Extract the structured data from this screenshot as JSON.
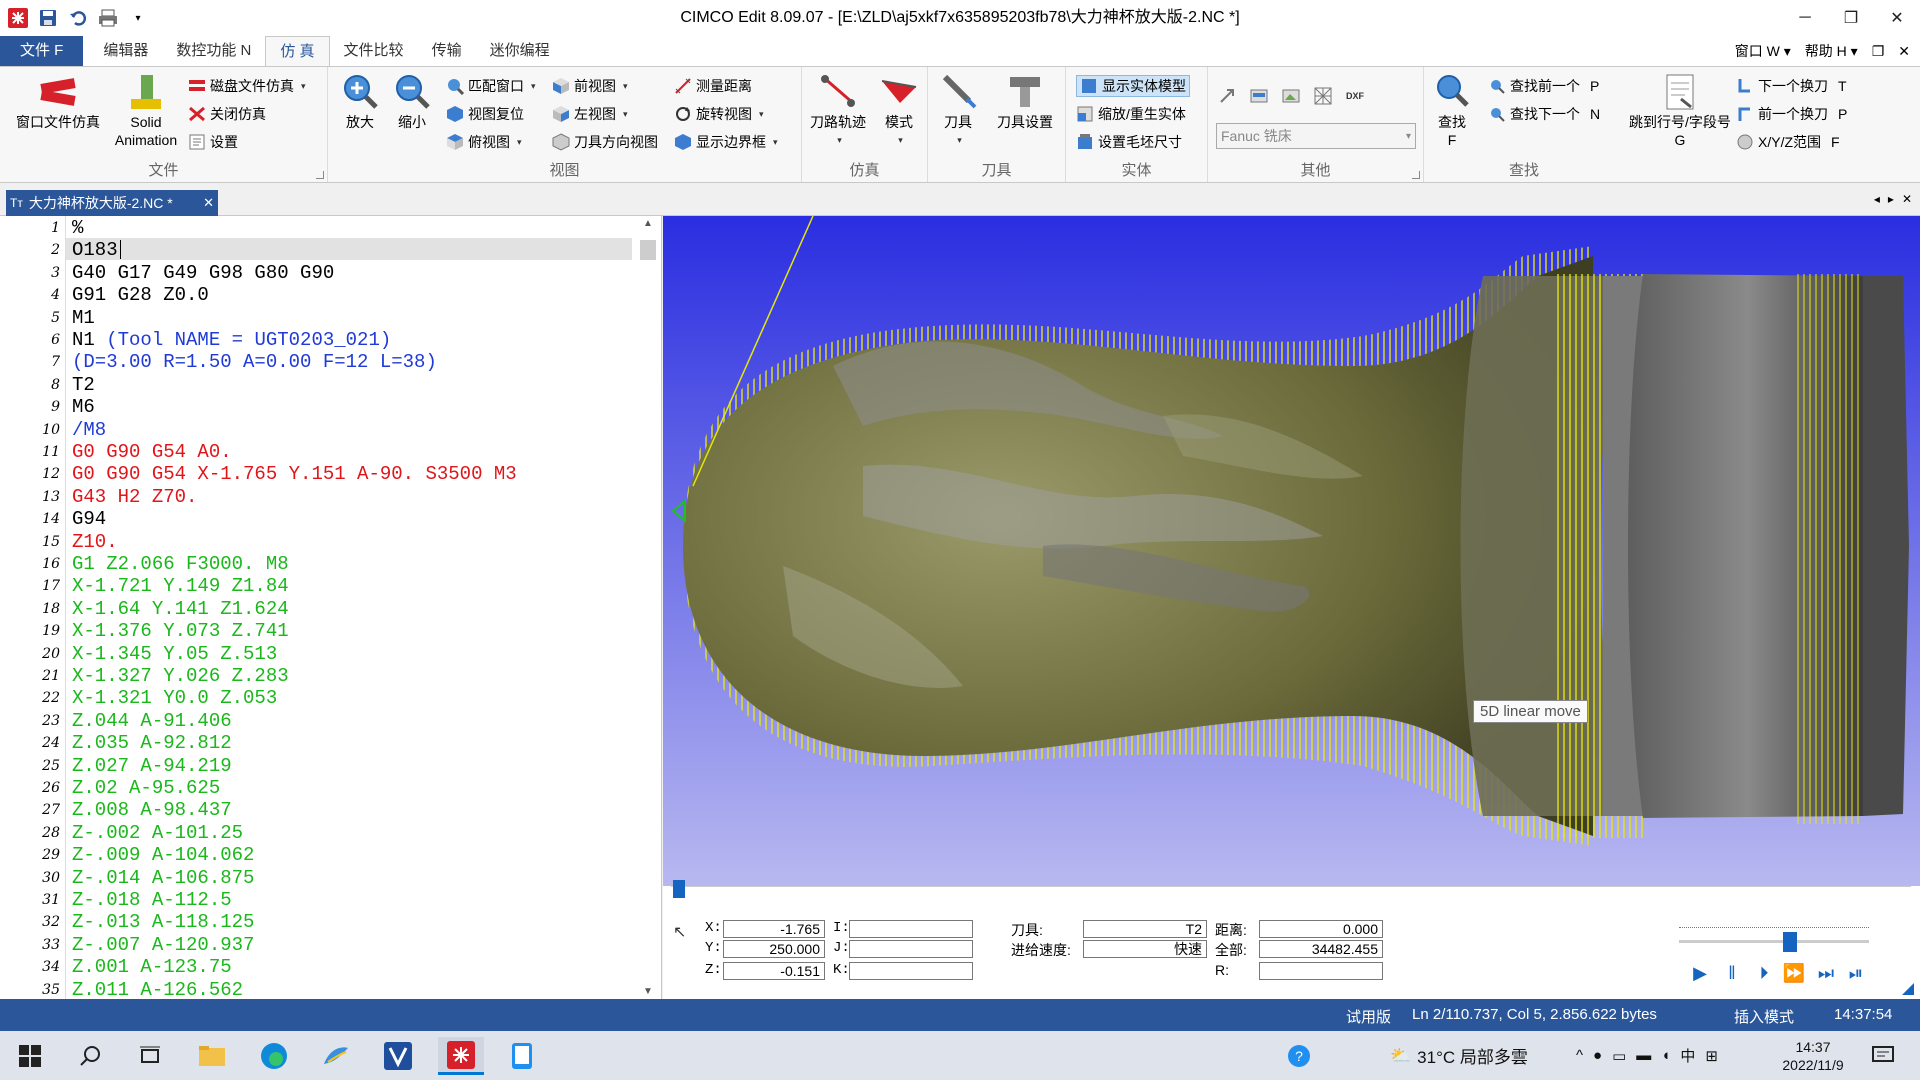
{
  "window": {
    "title": "CIMCO Edit 8.09.07 - [E:\\ZLD\\aj5xkf7x635895203fb78\\大力神杯放大版-2.NC *]"
  },
  "tabs": [
    {
      "label": "文件 F"
    },
    {
      "label": "编辑器"
    },
    {
      "label": "数控功能 N"
    },
    {
      "label": "仿 真"
    },
    {
      "label": "文件比较"
    },
    {
      "label": "传输"
    },
    {
      "label": "迷你编程"
    }
  ],
  "tabs_right": {
    "window_menu": "窗口 W",
    "help_menu": "帮助 H"
  },
  "ribbon": {
    "file_group": {
      "label": "文件",
      "window_file_sim": "窗口文件仿真",
      "solid_animation": "Solid\nAnimation",
      "disk_file_sim": "磁盘文件仿真",
      "close_sim": "关闭仿真",
      "settings": "设置"
    },
    "view_group": {
      "label": "视图",
      "zoom_in": "放大",
      "zoom_out": "缩小",
      "fit_window": "匹配窗口",
      "reset_view": "视图复位",
      "top_view": "俯视图",
      "front_view": "前视图",
      "left_view": "左视图",
      "tool_dir_view": "刀具方向视图",
      "measure": "测量距离",
      "rotate_view": "旋转视图",
      "show_bounds": "显示边界框"
    },
    "sim_group": {
      "label": "仿真",
      "toolpath": "刀路轨迹",
      "mode": "模式"
    },
    "tool_group": {
      "label": "刀具",
      "tool": "刀具",
      "tool_settings": "刀具设置"
    },
    "solid_group": {
      "label": "实体",
      "show_solid": "显示实体模型",
      "scale_regen": "缩放/重生实体",
      "stock_size": "设置毛坯尺寸"
    },
    "other_group": {
      "label": "其他",
      "machine_select": "Fanuc 铣床"
    },
    "find_group": {
      "label": "查找",
      "find": "查找",
      "find_key": "F",
      "find_prev": "查找前一个",
      "find_prev_key": "P",
      "find_next": "查找下一个",
      "find_next_key": "N",
      "jump_line": "跳到行号/字段号",
      "jump_key": "G",
      "next_tool_change": "下一个换刀",
      "next_tool_key": "T",
      "prev_tool_change": "前一个换刀",
      "prev_tool_key": "P",
      "xyz_range": "X/Y/Z范围",
      "xyz_key": "F"
    }
  },
  "doc_tab": {
    "label": "大力神杯放大版-2.NC *"
  },
  "editor": {
    "lines": [
      {
        "n": "1",
        "text": "%",
        "color": "#000000"
      },
      {
        "n": "2",
        "text": "O183",
        "color": "#000000"
      },
      {
        "n": "3",
        "text": "G40 G17 G49 G98 G80 G90",
        "color": "#000000"
      },
      {
        "n": "4",
        "text": "G91 G28 Z0.0",
        "color": "#000000"
      },
      {
        "n": "5",
        "text": "M1",
        "color": "#000000"
      },
      {
        "n": "6",
        "text": "N1 (Tool NAME = UGT0203_021)",
        "color": "#000000",
        "comment": "(Tool NAME = UGT0203_021)",
        "prefix": "N1 "
      },
      {
        "n": "7",
        "text": "(D=3.00 R=1.50 A=0.00 F=12 L=38)",
        "color": "#1f3ad6"
      },
      {
        "n": "8",
        "text": "T2",
        "color": "#000000"
      },
      {
        "n": "9",
        "text": "M6",
        "color": "#000000"
      },
      {
        "n": "10",
        "text": "/M8",
        "color": "#1f3ad6"
      },
      {
        "n": "11",
        "text": "G0 G90 G54 A0.",
        "color": "#e0151a"
      },
      {
        "n": "12",
        "text": "G0 G90 G54 X-1.765 Y.151 A-90. S3500 M3",
        "color": "#e0151a"
      },
      {
        "n": "13",
        "text": "G43 H2 Z70.",
        "color": "#e0151a"
      },
      {
        "n": "14",
        "text": "G94",
        "color": "#000000"
      },
      {
        "n": "15",
        "text": "Z10.",
        "color": "#e0151a"
      },
      {
        "n": "16",
        "text": "G1 Z2.066 F3000. M8",
        "color": "#1bb81b"
      },
      {
        "n": "17",
        "text": "X-1.721 Y.149 Z1.84",
        "color": "#1bb81b"
      },
      {
        "n": "18",
        "text": "X-1.64 Y.141 Z1.624",
        "color": "#1bb81b"
      },
      {
        "n": "19",
        "text": "X-1.376 Y.073 Z.741",
        "color": "#1bb81b"
      },
      {
        "n": "20",
        "text": "X-1.345 Y.05 Z.513",
        "color": "#1bb81b"
      },
      {
        "n": "21",
        "text": "X-1.327 Y.026 Z.283",
        "color": "#1bb81b"
      },
      {
        "n": "22",
        "text": "X-1.321 Y0.0 Z.053",
        "color": "#1bb81b"
      },
      {
        "n": "23",
        "text": "Z.044 A-91.406",
        "color": "#1bb81b"
      },
      {
        "n": "24",
        "text": "Z.035 A-92.812",
        "color": "#1bb81b"
      },
      {
        "n": "25",
        "text": "Z.027 A-94.219",
        "color": "#1bb81b"
      },
      {
        "n": "26",
        "text": "Z.02 A-95.625",
        "color": "#1bb81b"
      },
      {
        "n": "27",
        "text": "Z.008 A-98.437",
        "color": "#1bb81b"
      },
      {
        "n": "28",
        "text": "Z-.002 A-101.25",
        "color": "#1bb81b"
      },
      {
        "n": "29",
        "text": "Z-.009 A-104.062",
        "color": "#1bb81b"
      },
      {
        "n": "30",
        "text": "Z-.014 A-106.875",
        "color": "#1bb81b"
      },
      {
        "n": "31",
        "text": "Z-.018 A-112.5",
        "color": "#1bb81b"
      },
      {
        "n": "32",
        "text": "Z-.013 A-118.125",
        "color": "#1bb81b"
      },
      {
        "n": "33",
        "text": "Z-.007 A-120.937",
        "color": "#1bb81b"
      },
      {
        "n": "34",
        "text": "Z.001 A-123.75",
        "color": "#1bb81b"
      },
      {
        "n": "35",
        "text": "Z.011 A-126.562",
        "color": "#1bb81b"
      }
    ]
  },
  "viewport": {
    "tooltip": "5D linear move",
    "bg_top": "#2a2ee0",
    "bg_bottom": "#b8b8f0",
    "toolpath_color": "#e6e60a"
  },
  "sim_panel": {
    "x_label": "X:",
    "x_value": "-1.765",
    "y_label": "Y:",
    "y_value": "250.000",
    "z_label": "Z:",
    "z_value": "-0.151",
    "i_label": "I:",
    "i_value": "",
    "j_label": "J:",
    "j_value": "",
    "k_label": "K:",
    "k_value": "",
    "tool_label": "刀具:",
    "tool_value": "T2",
    "feed_label": "进给速度:",
    "feed_value": "快速",
    "dist_label": "距离:",
    "dist_value": "0.000",
    "total_label": "全部:",
    "total_value": "34482.455",
    "r_label": "R:",
    "r_value": ""
  },
  "status": {
    "trial": "试用版",
    "position": "Ln 2/110.737, Col 5, 2.856.622 bytes",
    "mode": "插入模式",
    "time": "14:37:54"
  },
  "taskbar": {
    "weather": "31°C 局部多雲",
    "ime": "中",
    "clock_time": "14:37",
    "clock_date": "2022/11/9"
  },
  "colors": {
    "accent": "#2b579a",
    "status_bg": "#2b579a"
  }
}
